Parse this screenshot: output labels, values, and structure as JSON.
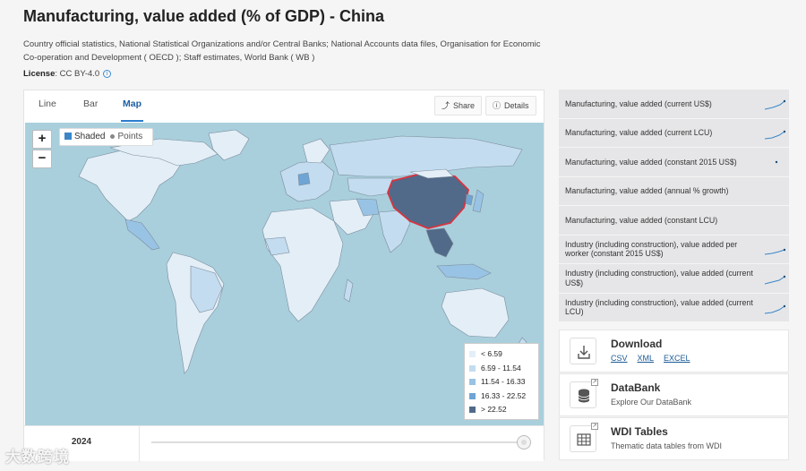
{
  "header": {
    "title": "Manufacturing, value added (% of GDP) - China",
    "source": "Country official statistics, National Statistical Organizations and/or Central Banks; National Accounts data files, Organisation for Economic Co-operation and Development ( OECD ); Staff estimates, World Bank ( WB )",
    "license_label": "License",
    "license_value": ": CC BY-4.0"
  },
  "tabs": [
    {
      "label": "Line",
      "active": false
    },
    {
      "label": "Bar",
      "active": false
    },
    {
      "label": "Map",
      "active": true
    }
  ],
  "toolbar": {
    "share_label": "Share",
    "details_label": "Details"
  },
  "map": {
    "zoom_in": "+",
    "zoom_out": "−",
    "mode_shaded": "Shaded",
    "mode_points": "Points",
    "highlighted_country": "China",
    "legend": [
      {
        "label": "< 6.59",
        "color": "#e3eef7"
      },
      {
        "label": "6.59 - 11.54",
        "color": "#c4dcef"
      },
      {
        "label": "11.54 - 16.33",
        "color": "#99c3e4"
      },
      {
        "label": "16.33 - 22.52",
        "color": "#6ea5d4"
      },
      {
        "label": "> 22.52",
        "color": "#516a89"
      }
    ]
  },
  "timeline": {
    "year": "2024",
    "position": 1.0
  },
  "related_indicators": [
    {
      "label": "Manufacturing, value added (current US$)",
      "sparkline": true
    },
    {
      "label": "Manufacturing, value added (current LCU)",
      "sparkline": true
    },
    {
      "label": "Manufacturing, value added (constant 2015 US$)",
      "sparkline": "dot"
    },
    {
      "label": "Manufacturing, value added (annual % growth)",
      "sparkline": false
    },
    {
      "label": "Manufacturing, value added (constant LCU)",
      "sparkline": false
    },
    {
      "label": "Industry (including construction), value added per worker (constant 2015 US$)",
      "sparkline": true
    },
    {
      "label": "Industry (including construction), value added (current US$)",
      "sparkline": true
    },
    {
      "label": "Industry (including construction), value added (current LCU)",
      "sparkline": true
    }
  ],
  "cards": {
    "download": {
      "title": "Download",
      "links": [
        "CSV",
        "XML",
        "EXCEL"
      ]
    },
    "databank": {
      "title": "DataBank",
      "subtitle": "Explore Our DataBank"
    },
    "wdi": {
      "title": "WDI Tables",
      "subtitle": "Thematic data tables from WDI"
    }
  },
  "watermark": "大数跨境",
  "colors": {
    "accent": "#2a7bd0",
    "sea": "#a9cfdc",
    "highlight_border": "#d9333f"
  }
}
